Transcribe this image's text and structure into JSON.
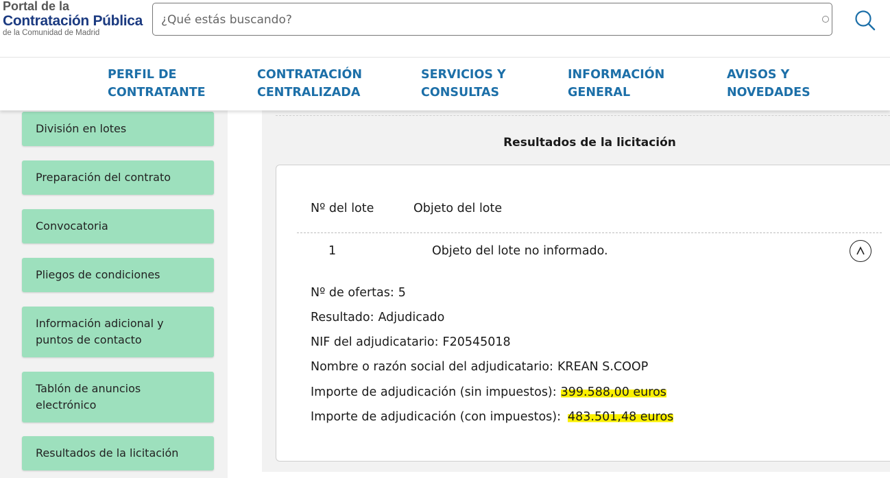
{
  "header": {
    "logo_line1": "Portal de la",
    "logo_line2": "Contratación Pública",
    "logo_line3": "de la Comunidad de Madrid",
    "search_placeholder": "¿Qué estás buscando?",
    "search_icon": "search-icon"
  },
  "nav": {
    "items": [
      {
        "label": "PERFIL DE\nCONTRATANTE"
      },
      {
        "label": "CONTRATACIÓN\nCENTRALIZADA"
      },
      {
        "label": "SERVICIOS Y\nCONSULTAS"
      },
      {
        "label": "INFORMACIÓN\nGENERAL"
      },
      {
        "label": "AVISOS Y\nNOVEDADES"
      }
    ]
  },
  "sidebar": {
    "items": [
      {
        "label": "División en lotes"
      },
      {
        "label": "Preparación del contrato"
      },
      {
        "label": "Convocatoria"
      },
      {
        "label": "Pliegos de condiciones"
      },
      {
        "label": "Información adicional y puntos de contacto"
      },
      {
        "label": "Tablón de anuncios electrónico"
      },
      {
        "label": "Resultados de la licitación"
      }
    ]
  },
  "main": {
    "section_title": "Resultados de la licitación",
    "table": {
      "headers": [
        "Nº del lote",
        "Objeto del lote"
      ],
      "row": {
        "lote": "1",
        "objeto": "Objeto del lote no informado."
      },
      "collapse_icon": "chevron-up-icon"
    },
    "details": [
      {
        "label": "Nº de ofertas:",
        "value": "5"
      },
      {
        "label": "Resultado:",
        "value": "Adjudicado"
      },
      {
        "label": "NIF del adjudicatario:",
        "value": "F20545018"
      },
      {
        "label": "Nombre o razón social del adjudicatario:",
        "value": "KREAN S.COOP"
      },
      {
        "label": "Importe de adjudicación (sin impuestos):",
        "value": "399.588,00 euros"
      },
      {
        "label": "Importe de adjudicación (con impuestos):",
        "value": "483.501,48 euros"
      }
    ],
    "highlight_color": "#fbf000"
  },
  "colors": {
    "nav_text": "#1c6fa8",
    "sidebar_button": "#9de0bd",
    "logo_blue": "#1b3a80"
  }
}
